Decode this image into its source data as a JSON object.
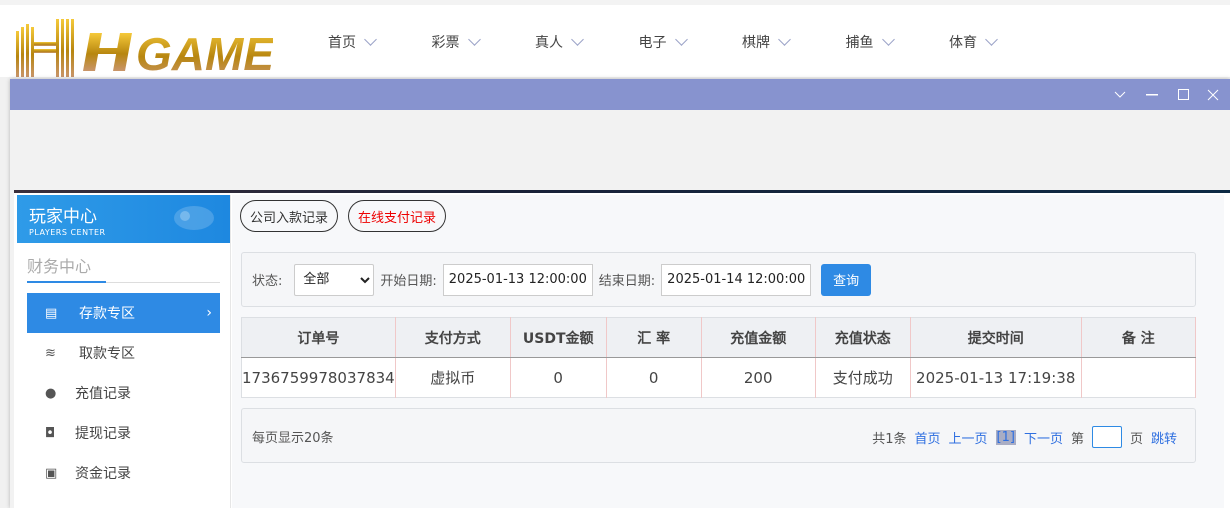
{
  "brand": {
    "logo_text": "HH GAME"
  },
  "nav": [
    {
      "label": "首页"
    },
    {
      "label": "彩票"
    },
    {
      "label": "真人"
    },
    {
      "label": "电子"
    },
    {
      "label": "棋牌"
    },
    {
      "label": "捕鱼"
    },
    {
      "label": "体育"
    }
  ],
  "window": {
    "controls": [
      "chevron-down",
      "minimize",
      "maximize",
      "close"
    ]
  },
  "sidebar": {
    "title": "玩家中心",
    "subtitle": "PLAYERS CENTER",
    "section": "财务中心",
    "items": [
      {
        "label": "存款专区",
        "icon": "card-icon",
        "active": true
      },
      {
        "label": "取款专区",
        "icon": "hand-money-icon"
      },
      {
        "label": "充值记录",
        "icon": "money-bag-icon"
      },
      {
        "label": "提现记录",
        "icon": "wallet-icon"
      },
      {
        "label": "资金记录",
        "icon": "safe-icon"
      }
    ]
  },
  "tabs": [
    {
      "label": "公司入款记录"
    },
    {
      "label": "在线支付记录"
    }
  ],
  "filter": {
    "status_label": "状态:",
    "status_value": "全部",
    "start_label": "开始日期:",
    "start_value": "2025-01-13 12:00:00",
    "end_label": "结束日期:",
    "end_value": "2025-01-14 12:00:00",
    "query": "查询"
  },
  "table": {
    "headers": [
      "订单号",
      "支付方式",
      "USDT金额",
      "汇 率",
      "充值金额",
      "充值状态",
      "提交时间",
      "备 注"
    ],
    "rows": [
      [
        "1736759978037834",
        "虚拟币",
        "0",
        "0",
        "200",
        "支付成功",
        "2025-01-13 17:19:38",
        ""
      ]
    ]
  },
  "pager": {
    "per_page": "每页显示20条",
    "total": "共1条",
    "first": "首页",
    "prev": "上一页",
    "current": "[1]",
    "next": "下一页",
    "page_prefix": "第",
    "page_suffix": "页",
    "jump": "跳转"
  },
  "colors": {
    "accent": "#2e8ae4",
    "titlebar": "#8793cf",
    "tab_active_text": "#e00000"
  }
}
